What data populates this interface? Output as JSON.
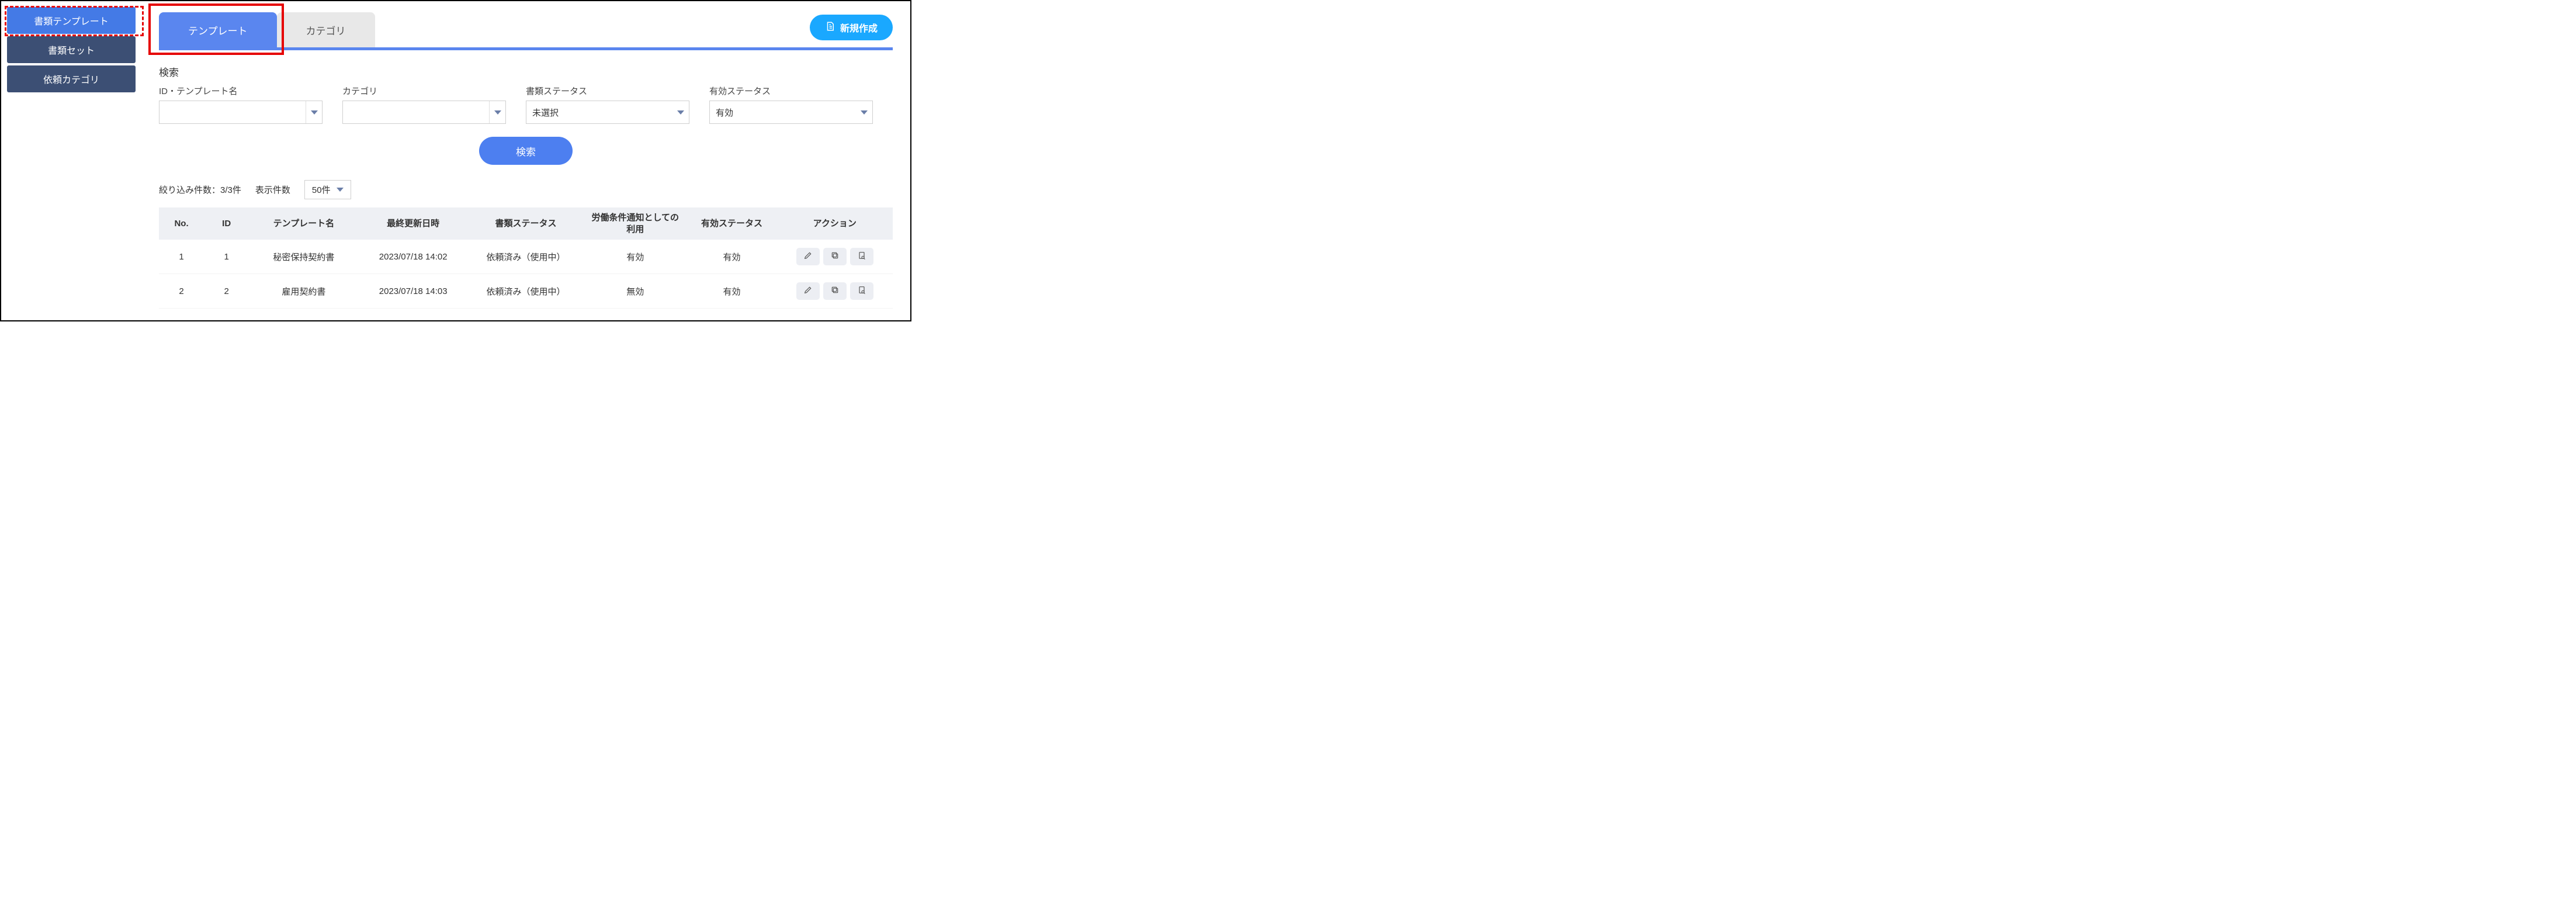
{
  "sidebar": {
    "items": [
      {
        "label": "書類テンプレート",
        "active": true
      },
      {
        "label": "書類セット",
        "active": false
      },
      {
        "label": "依頼カテゴリ",
        "active": false
      }
    ]
  },
  "tabs": {
    "template": "テンプレート",
    "category": "カテゴリ"
  },
  "new_button": "新規作成",
  "search": {
    "title": "検索",
    "filters": {
      "id_name": {
        "label": "ID・テンプレート名",
        "value": ""
      },
      "category": {
        "label": "カテゴリ",
        "value": ""
      },
      "doc_status": {
        "label": "書類ステータス",
        "value": "未選択"
      },
      "valid_status": {
        "label": "有効ステータス",
        "value": "有効"
      }
    },
    "button": "検索"
  },
  "results": {
    "filter_count_label": "絞り込み件数：",
    "filter_count_value": "3/3件",
    "page_size_label": "表示件数",
    "page_size_value": "50件"
  },
  "table": {
    "headers": {
      "no": "No.",
      "id": "ID",
      "name": "テンプレート名",
      "updated": "最終更新日時",
      "doc_status": "書類ステータス",
      "labor_notice": "労働条件通知としての利用",
      "valid_status": "有効ステータス",
      "action": "アクション"
    },
    "rows": [
      {
        "no": "1",
        "id": "1",
        "name": "秘密保持契約書",
        "updated": "2023/07/18 14:02",
        "doc_status": "依頼済み（使用中）",
        "labor": "有効",
        "valid": "有効"
      },
      {
        "no": "2",
        "id": "2",
        "name": "雇用契約書",
        "updated": "2023/07/18 14:03",
        "doc_status": "依頼済み（使用中）",
        "labor": "無効",
        "valid": "有効"
      }
    ]
  }
}
